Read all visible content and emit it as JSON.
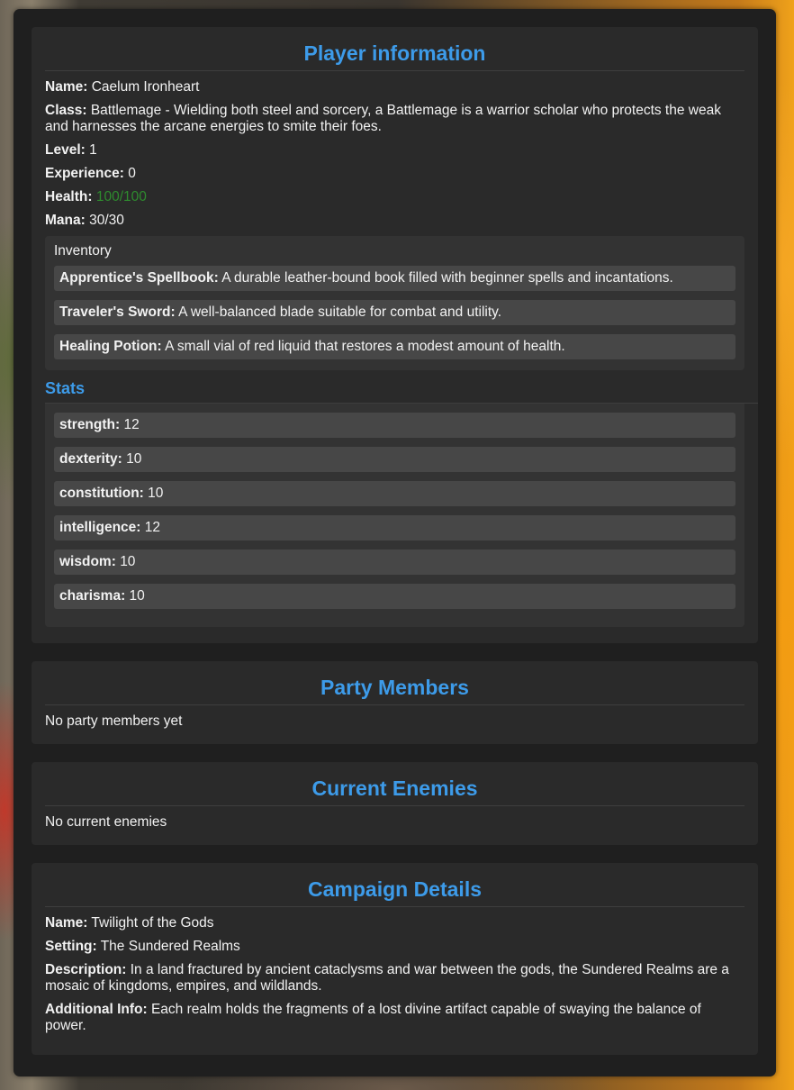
{
  "player": {
    "title": "Player information",
    "name_label": "Name:",
    "name": "Caelum Ironheart",
    "class_label": "Class:",
    "class": "Battlemage - Wielding both steel and sorcery, a Battlemage is a warrior scholar who protects the weak and harnesses the arcane energies to smite their foes.",
    "level_label": "Level:",
    "level": "1",
    "experience_label": "Experience:",
    "experience": "0",
    "health_label": "Health:",
    "health": "100/100",
    "mana_label": "Mana:",
    "mana": "30/30",
    "inventory_heading": "Inventory",
    "inventory": [
      {
        "name": "Apprentice's Spellbook:",
        "desc": "A durable leather-bound book filled with beginner spells and incantations."
      },
      {
        "name": "Traveler's Sword:",
        "desc": "A well-balanced blade suitable for combat and utility."
      },
      {
        "name": "Healing Potion:",
        "desc": "A small vial of red liquid that restores a modest amount of health."
      }
    ],
    "stats_heading": "Stats",
    "stats": [
      {
        "name": "strength:",
        "value": "12"
      },
      {
        "name": "dexterity:",
        "value": "10"
      },
      {
        "name": "constitution:",
        "value": "10"
      },
      {
        "name": "intelligence:",
        "value": "12"
      },
      {
        "name": "wisdom:",
        "value": "10"
      },
      {
        "name": "charisma:",
        "value": "10"
      }
    ]
  },
  "party": {
    "title": "Party Members",
    "empty_text": "No party members yet"
  },
  "enemies": {
    "title": "Current Enemies",
    "empty_text": "No current enemies"
  },
  "campaign": {
    "title": "Campaign Details",
    "name_label": "Name:",
    "name": "Twilight of the Gods",
    "setting_label": "Setting:",
    "setting": "The Sundered Realms",
    "description_label": "Description:",
    "description": "In a land fractured by ancient cataclysms and war between the gods, the Sundered Realms are a mosaic of kingdoms, empires, and wildlands.",
    "additional_label": "Additional Info:",
    "additional": "Each realm holds the fragments of a lost divine artifact capable of swaying the balance of power."
  },
  "colors": {
    "accent": "#3d9be9",
    "health": "#2e8b2e",
    "panel": "#1f1f1f",
    "card": "#2a2a2a"
  }
}
